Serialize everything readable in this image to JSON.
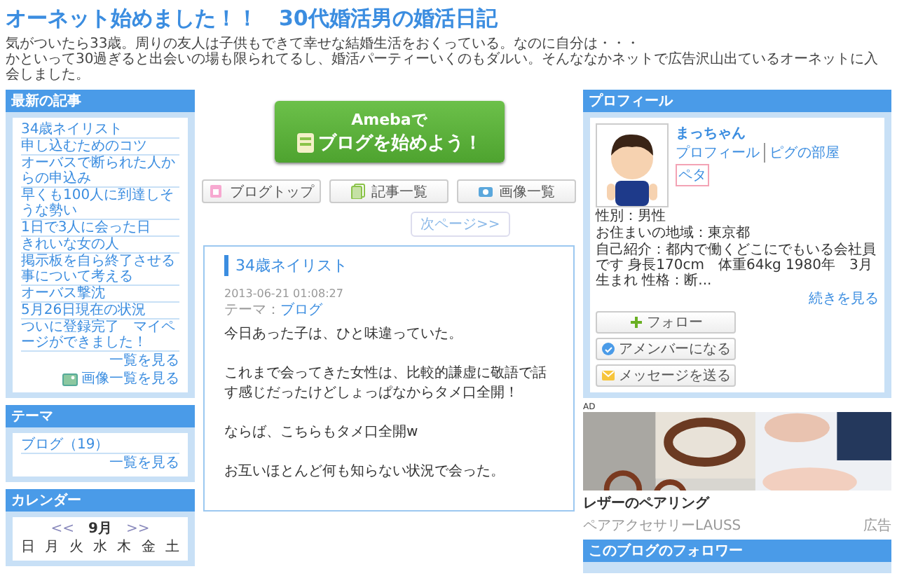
{
  "header": {
    "title": "オーネット始めました！！　30代婚活男の婚活日記",
    "description": [
      "気がついたら33歳。周りの友人は子供もできて幸せな結婚生活をおくっている。なのに自分は・・・",
      "かといって30過ぎると出会いの場も限られてるし、婚活パーティーいくのもダルい。そんななかネットで広告沢山出ているオーネットに入会しました。"
    ]
  },
  "sidebar": {
    "recent": {
      "heading": "最新の記事",
      "items": [
        "34歳ネイリスト",
        "申し込むためのコツ",
        "オーバスで断られた人からの申込み",
        "早くも100人に到達しそうな勢い",
        "1日で3人に会った日",
        "きれいな女の人",
        "掲示板を自ら終了させる事について考える",
        "オーバス撃沈",
        "5月26日現在の状況",
        "ついに登録完了　マイページができました！"
      ],
      "more_link": "一覧を見る",
      "images_link": "画像一覧を見る"
    },
    "theme": {
      "heading": "テーマ",
      "items": [
        "ブログ（19）"
      ],
      "more_link": "一覧を見る"
    },
    "calendar": {
      "heading": "カレンダー",
      "prev": "<<",
      "month": "9月",
      "next": ">>",
      "weekdays": [
        "日",
        "月",
        "火",
        "水",
        "木",
        "金",
        "土"
      ]
    }
  },
  "main": {
    "promo": {
      "line1": "Amebaで",
      "line2": "ブログを始めよう！"
    },
    "nav": [
      {
        "label": "ブログトップ",
        "kind": "top"
      },
      {
        "label": "記事一覧",
        "kind": "articles"
      },
      {
        "label": "画像一覧",
        "kind": "images"
      }
    ],
    "next_page": "次ページ>>",
    "article": {
      "title": "34歳ネイリスト",
      "date": "2013-06-21 01:08:27",
      "theme_label": "テーマ：",
      "theme": "ブログ",
      "paragraphs": [
        "今日あった子は、ひと味違っていた。",
        "これまで会ってきた女性は、比較的謙虚に敬語で話す感じだったけどしょっぱなからタメ口全開！",
        "ならば、こちらもタメ口全開w",
        "お互いほとんど何も知らない状況で会った。"
      ]
    }
  },
  "profile": {
    "heading": "プロフィール",
    "name": "まっちゃん",
    "links": [
      "プロフィール",
      "ピグの部屋"
    ],
    "peta": "ペタ",
    "details": [
      "性別：男性",
      "お住まいの地域：東京都",
      "自己紹介：都内で働くどこにでもいる会社員です 身長170cm　体重64kg 1980年　3月生まれ 性格：断..."
    ],
    "more": "続きを見る",
    "buttons": [
      {
        "label": "フォロー",
        "kind": "follow"
      },
      {
        "label": "アメンバーになる",
        "kind": "member"
      },
      {
        "label": "メッセージを送る",
        "kind": "message"
      }
    ]
  },
  "ad": {
    "badge": "AD",
    "title": "レザーのペアリング",
    "advertiser": "ペアアクセサリーLAUSS",
    "label": "広告"
  },
  "followers": {
    "heading": "このブログのフォロワー"
  }
}
